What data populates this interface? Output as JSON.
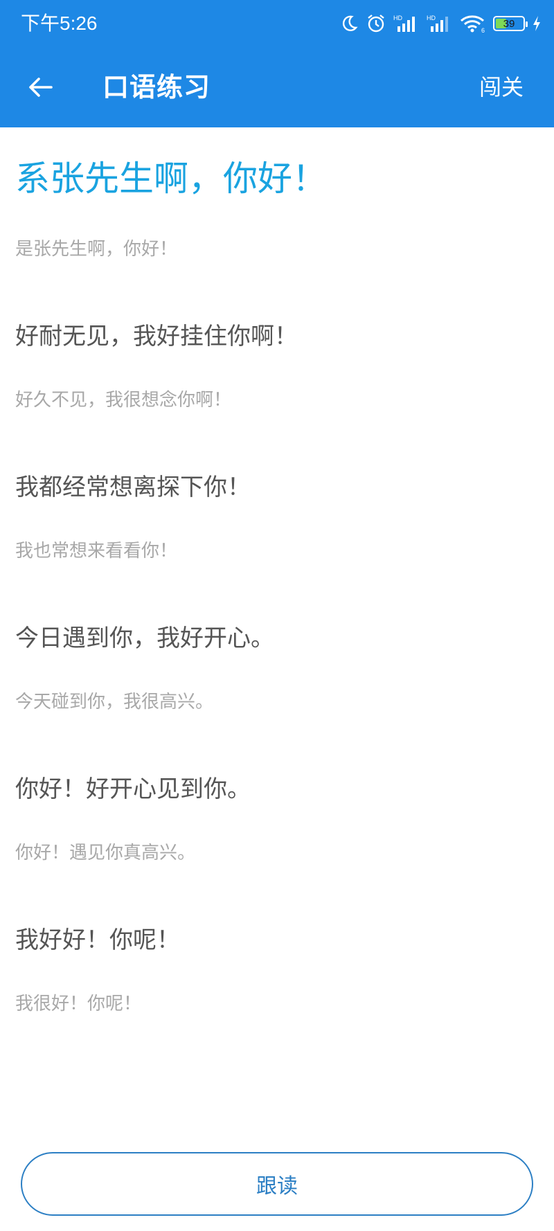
{
  "status_bar": {
    "time": "下午5:26",
    "battery": "39",
    "battery_level": 0.39,
    "icons": [
      "moon-icon",
      "alarm-icon",
      "hd-signal-icon",
      "hd-signal-icon",
      "wifi-icon",
      "battery-icon",
      "charging-icon"
    ],
    "hd_label": "HD",
    "wifi_badge": "6"
  },
  "app_bar": {
    "title": "口语练习",
    "action": "闯关",
    "background": "#1e88e5"
  },
  "phrases": [
    {
      "main": "系张先生啊，你好！",
      "sub": "是张先生啊，你好！",
      "active": true
    },
    {
      "main": "好耐无见，我好挂住你啊！",
      "sub": "好久不见，我很想念你啊！",
      "active": false
    },
    {
      "main": "我都经常想离探下你！",
      "sub": "我也常想来看看你！",
      "active": false
    },
    {
      "main": "今日遇到你，我好开心。",
      "sub": "今天碰到你，我很高兴。",
      "active": false
    },
    {
      "main": "你好！好开心见到你。",
      "sub": "你好！遇见你真高兴。",
      "active": false
    },
    {
      "main": "我好好！你呢！",
      "sub": "我很好！你呢！",
      "active": false
    }
  ],
  "follow_button": {
    "label": "跟读"
  },
  "colors": {
    "accent": "#1aa3e0",
    "main_text": "#555555",
    "sub_text": "#a8a8a8",
    "button_border": "#2c7fc4"
  }
}
